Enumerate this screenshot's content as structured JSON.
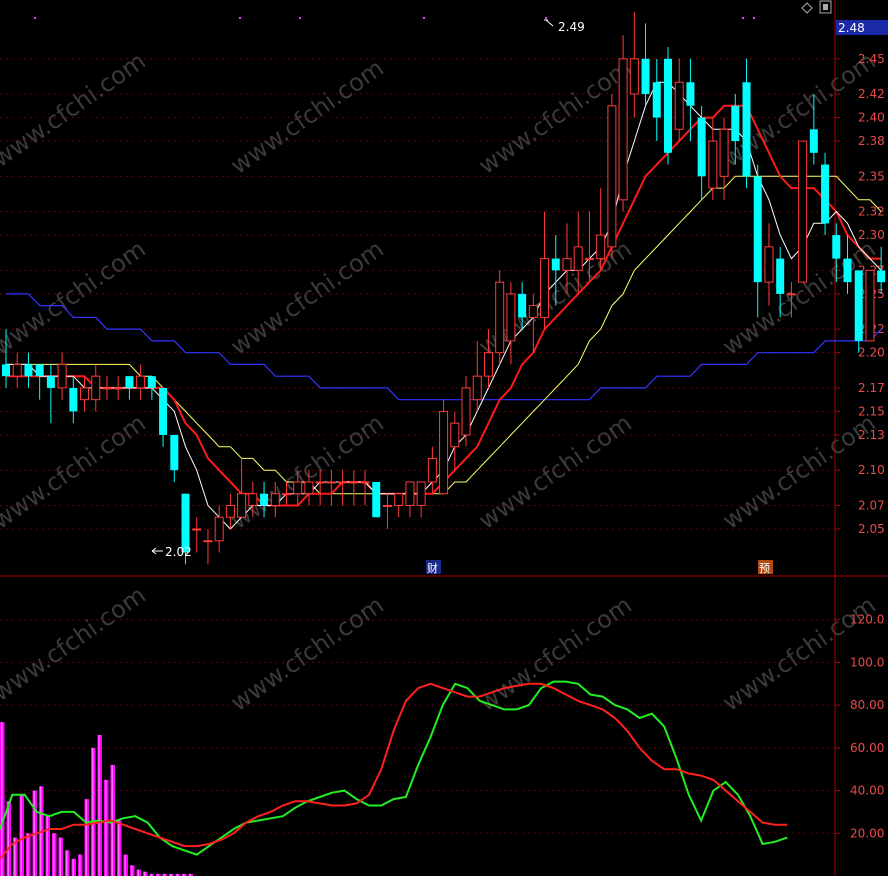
{
  "toolbar": {
    "diamond_icon": "diamond-icon",
    "window_icon": "restore-window-icon"
  },
  "price_axis": {
    "current_price": "2.48",
    "ticks": [
      "2.45",
      "2.42",
      "2.40",
      "2.38",
      "2.35",
      "2.32",
      "2.30",
      "2.27",
      "2.25",
      "2.22",
      "2.20",
      "2.17",
      "2.15",
      "2.13",
      "2.10",
      "2.07",
      "2.05"
    ]
  },
  "osc_axis": {
    "ticks": [
      "120.0",
      "100.0",
      "80.00",
      "60.00",
      "40.00",
      "20.00"
    ]
  },
  "annotations": {
    "high": "2.49",
    "low": "2.02"
  },
  "markers": {
    "earnings": "财",
    "forecast": "预"
  },
  "watermark": "www.cfchi.com",
  "colors": {
    "background": "#000000",
    "up": "#ff3a3a",
    "down": "#00ffff",
    "ma_short": "#ffffff",
    "ma_mid": "#ff1a1a",
    "ma_long": "#ffff66",
    "ma_xlong": "#3333ff",
    "osc_fast": "#22ee22",
    "osc_slow": "#ff2020",
    "osc_bars": "#ff00ff",
    "grid": "#6a0000"
  },
  "chart_data": [
    {
      "type": "candlestick",
      "ylim": [
        2.01,
        2.5
      ],
      "candles": [
        {
          "o": 2.19,
          "h": 2.22,
          "l": 2.17,
          "c": 2.18
        },
        {
          "o": 2.18,
          "h": 2.2,
          "l": 2.17,
          "c": 2.19
        },
        {
          "o": 2.19,
          "h": 2.2,
          "l": 2.17,
          "c": 2.18
        },
        {
          "o": 2.19,
          "h": 2.19,
          "l": 2.16,
          "c": 2.18
        },
        {
          "o": 2.18,
          "h": 2.19,
          "l": 2.14,
          "c": 2.17
        },
        {
          "o": 2.17,
          "h": 2.2,
          "l": 2.16,
          "c": 2.19
        },
        {
          "o": 2.17,
          "h": 2.18,
          "l": 2.14,
          "c": 2.15
        },
        {
          "o": 2.16,
          "h": 2.18,
          "l": 2.15,
          "c": 2.17
        },
        {
          "o": 2.16,
          "h": 2.19,
          "l": 2.15,
          "c": 2.18
        },
        {
          "o": 2.17,
          "h": 2.18,
          "l": 2.16,
          "c": 2.17
        },
        {
          "o": 2.17,
          "h": 2.18,
          "l": 2.16,
          "c": 2.17
        },
        {
          "o": 2.18,
          "h": 2.18,
          "l": 2.16,
          "c": 2.17
        },
        {
          "o": 2.17,
          "h": 2.19,
          "l": 2.16,
          "c": 2.18
        },
        {
          "o": 2.18,
          "h": 2.18,
          "l": 2.16,
          "c": 2.17
        },
        {
          "o": 2.17,
          "h": 2.17,
          "l": 2.12,
          "c": 2.13
        },
        {
          "o": 2.13,
          "h": 2.13,
          "l": 2.09,
          "c": 2.1
        },
        {
          "o": 2.08,
          "h": 2.08,
          "l": 2.02,
          "c": 2.03
        },
        {
          "o": 2.05,
          "h": 2.06,
          "l": 2.03,
          "c": 2.05
        },
        {
          "o": 2.04,
          "h": 2.05,
          "l": 2.02,
          "c": 2.04
        },
        {
          "o": 2.04,
          "h": 2.07,
          "l": 2.03,
          "c": 2.06
        },
        {
          "o": 2.06,
          "h": 2.08,
          "l": 2.05,
          "c": 2.07
        },
        {
          "o": 2.06,
          "h": 2.11,
          "l": 2.06,
          "c": 2.08
        },
        {
          "o": 2.07,
          "h": 2.09,
          "l": 2.06,
          "c": 2.08
        },
        {
          "o": 2.08,
          "h": 2.09,
          "l": 2.06,
          "c": 2.07
        },
        {
          "o": 2.07,
          "h": 2.09,
          "l": 2.06,
          "c": 2.08
        },
        {
          "o": 2.08,
          "h": 2.09,
          "l": 2.07,
          "c": 2.08
        },
        {
          "o": 2.08,
          "h": 2.1,
          "l": 2.07,
          "c": 2.09
        },
        {
          "o": 2.08,
          "h": 2.1,
          "l": 2.07,
          "c": 2.09
        },
        {
          "o": 2.09,
          "h": 2.1,
          "l": 2.07,
          "c": 2.09
        },
        {
          "o": 2.09,
          "h": 2.1,
          "l": 2.07,
          "c": 2.09
        },
        {
          "o": 2.09,
          "h": 2.1,
          "l": 2.07,
          "c": 2.09
        },
        {
          "o": 2.09,
          "h": 2.1,
          "l": 2.07,
          "c": 2.09
        },
        {
          "o": 2.09,
          "h": 2.1,
          "l": 2.07,
          "c": 2.09
        },
        {
          "o": 2.09,
          "h": 2.09,
          "l": 2.06,
          "c": 2.06
        },
        {
          "o": 2.07,
          "h": 2.08,
          "l": 2.05,
          "c": 2.07
        },
        {
          "o": 2.07,
          "h": 2.08,
          "l": 2.06,
          "c": 2.08
        },
        {
          "o": 2.07,
          "h": 2.09,
          "l": 2.06,
          "c": 2.09
        },
        {
          "o": 2.07,
          "h": 2.09,
          "l": 2.06,
          "c": 2.09
        },
        {
          "o": 2.09,
          "h": 2.12,
          "l": 2.08,
          "c": 2.11
        },
        {
          "o": 2.08,
          "h": 2.16,
          "l": 2.08,
          "c": 2.15
        },
        {
          "o": 2.12,
          "h": 2.15,
          "l": 2.1,
          "c": 2.14
        },
        {
          "o": 2.13,
          "h": 2.18,
          "l": 2.12,
          "c": 2.17
        },
        {
          "o": 2.16,
          "h": 2.21,
          "l": 2.15,
          "c": 2.18
        },
        {
          "o": 2.18,
          "h": 2.22,
          "l": 2.17,
          "c": 2.2
        },
        {
          "o": 2.2,
          "h": 2.27,
          "l": 2.19,
          "c": 2.26
        },
        {
          "o": 2.21,
          "h": 2.26,
          "l": 2.19,
          "c": 2.25
        },
        {
          "o": 2.25,
          "h": 2.26,
          "l": 2.22,
          "c": 2.23
        },
        {
          "o": 2.23,
          "h": 2.25,
          "l": 2.2,
          "c": 2.24
        },
        {
          "o": 2.23,
          "h": 2.32,
          "l": 2.22,
          "c": 2.28
        },
        {
          "o": 2.28,
          "h": 2.3,
          "l": 2.24,
          "c": 2.27
        },
        {
          "o": 2.27,
          "h": 2.31,
          "l": 2.25,
          "c": 2.28
        },
        {
          "o": 2.27,
          "h": 2.32,
          "l": 2.25,
          "c": 2.29
        },
        {
          "o": 2.28,
          "h": 2.32,
          "l": 2.26,
          "c": 2.28
        },
        {
          "o": 2.28,
          "h": 2.34,
          "l": 2.27,
          "c": 2.3
        },
        {
          "o": 2.29,
          "h": 2.42,
          "l": 2.28,
          "c": 2.41
        },
        {
          "o": 2.33,
          "h": 2.47,
          "l": 2.32,
          "c": 2.45
        },
        {
          "o": 2.42,
          "h": 2.49,
          "l": 2.4,
          "c": 2.45
        },
        {
          "o": 2.45,
          "h": 2.48,
          "l": 2.41,
          "c": 2.42
        },
        {
          "o": 2.43,
          "h": 2.45,
          "l": 2.38,
          "c": 2.4
        },
        {
          "o": 2.45,
          "h": 2.46,
          "l": 2.36,
          "c": 2.37
        },
        {
          "o": 2.39,
          "h": 2.45,
          "l": 2.38,
          "c": 2.43
        },
        {
          "o": 2.43,
          "h": 2.45,
          "l": 2.38,
          "c": 2.41
        },
        {
          "o": 2.4,
          "h": 2.41,
          "l": 2.33,
          "c": 2.35
        },
        {
          "o": 2.34,
          "h": 2.4,
          "l": 2.33,
          "c": 2.38
        },
        {
          "o": 2.35,
          "h": 2.4,
          "l": 2.33,
          "c": 2.39
        },
        {
          "o": 2.41,
          "h": 2.42,
          "l": 2.36,
          "c": 2.38
        },
        {
          "o": 2.43,
          "h": 2.45,
          "l": 2.34,
          "c": 2.35
        },
        {
          "o": 2.35,
          "h": 2.36,
          "l": 2.23,
          "c": 2.26
        },
        {
          "o": 2.26,
          "h": 2.31,
          "l": 2.24,
          "c": 2.29
        },
        {
          "o": 2.28,
          "h": 2.29,
          "l": 2.23,
          "c": 2.25
        },
        {
          "o": 2.25,
          "h": 2.26,
          "l": 2.23,
          "c": 2.25
        },
        {
          "o": 2.26,
          "h": 2.38,
          "l": 2.26,
          "c": 2.38
        },
        {
          "o": 2.39,
          "h": 2.42,
          "l": 2.36,
          "c": 2.37
        },
        {
          "o": 2.36,
          "h": 2.37,
          "l": 2.3,
          "c": 2.31
        },
        {
          "o": 2.3,
          "h": 2.31,
          "l": 2.26,
          "c": 2.28
        },
        {
          "o": 2.28,
          "h": 2.3,
          "l": 2.25,
          "c": 2.26
        },
        {
          "o": 2.27,
          "h": 2.27,
          "l": 2.2,
          "c": 2.21
        },
        {
          "o": 2.21,
          "h": 2.27,
          "l": 2.21,
          "c": 2.27
        },
        {
          "o": 2.27,
          "h": 2.29,
          "l": 2.25,
          "c": 2.26
        }
      ],
      "ma_short": [
        2.19,
        2.19,
        2.19,
        2.18,
        2.18,
        2.18,
        2.18,
        2.17,
        2.17,
        2.17,
        2.17,
        2.17,
        2.17,
        2.17,
        2.16,
        2.15,
        2.12,
        2.1,
        2.07,
        2.06,
        2.05,
        2.06,
        2.07,
        2.07,
        2.07,
        2.08,
        2.08,
        2.08,
        2.09,
        2.09,
        2.09,
        2.09,
        2.09,
        2.08,
        2.08,
        2.08,
        2.08,
        2.08,
        2.09,
        2.1,
        2.12,
        2.13,
        2.15,
        2.17,
        2.19,
        2.21,
        2.22,
        2.23,
        2.25,
        2.26,
        2.27,
        2.27,
        2.28,
        2.29,
        2.31,
        2.35,
        2.38,
        2.41,
        2.43,
        2.43,
        2.42,
        2.41,
        2.4,
        2.39,
        2.39,
        2.39,
        2.38,
        2.35,
        2.33,
        2.3,
        2.28,
        2.29,
        2.31,
        2.31,
        2.32,
        2.31,
        2.29,
        2.28,
        2.27
      ],
      "ma_mid": [
        2.18,
        2.18,
        2.18,
        2.18,
        2.18,
        2.18,
        2.18,
        2.18,
        2.17,
        2.17,
        2.17,
        2.17,
        2.17,
        2.17,
        2.17,
        2.16,
        2.14,
        2.13,
        2.11,
        2.1,
        2.09,
        2.08,
        2.08,
        2.07,
        2.07,
        2.07,
        2.07,
        2.08,
        2.08,
        2.08,
        2.09,
        2.09,
        2.09,
        2.08,
        2.08,
        2.08,
        2.08,
        2.08,
        2.08,
        2.09,
        2.1,
        2.11,
        2.12,
        2.14,
        2.16,
        2.17,
        2.19,
        2.2,
        2.22,
        2.23,
        2.24,
        2.25,
        2.26,
        2.27,
        2.29,
        2.31,
        2.33,
        2.35,
        2.36,
        2.37,
        2.38,
        2.39,
        2.4,
        2.4,
        2.41,
        2.41,
        2.41,
        2.39,
        2.37,
        2.35,
        2.34,
        2.34,
        2.34,
        2.33,
        2.32,
        2.3,
        2.29,
        2.28,
        2.28
      ],
      "ma_long": [
        2.19,
        2.19,
        2.19,
        2.19,
        2.19,
        2.19,
        2.19,
        2.19,
        2.19,
        2.19,
        2.19,
        2.19,
        2.18,
        2.18,
        2.17,
        2.16,
        2.15,
        2.14,
        2.13,
        2.12,
        2.12,
        2.11,
        2.11,
        2.1,
        2.1,
        2.09,
        2.09,
        2.09,
        2.08,
        2.08,
        2.08,
        2.08,
        2.08,
        2.08,
        2.08,
        2.08,
        2.08,
        2.08,
        2.08,
        2.08,
        2.09,
        2.09,
        2.1,
        2.11,
        2.12,
        2.13,
        2.14,
        2.15,
        2.16,
        2.17,
        2.18,
        2.19,
        2.21,
        2.22,
        2.24,
        2.25,
        2.27,
        2.28,
        2.29,
        2.3,
        2.31,
        2.32,
        2.33,
        2.34,
        2.34,
        2.35,
        2.35,
        2.35,
        2.35,
        2.35,
        2.35,
        2.35,
        2.35,
        2.35,
        2.35,
        2.34,
        2.33,
        2.33,
        2.32
      ],
      "ma_xlong": [
        2.25,
        2.25,
        2.25,
        2.24,
        2.24,
        2.24,
        2.23,
        2.23,
        2.23,
        2.22,
        2.22,
        2.22,
        2.22,
        2.21,
        2.21,
        2.21,
        2.2,
        2.2,
        2.2,
        2.2,
        2.19,
        2.19,
        2.19,
        2.19,
        2.18,
        2.18,
        2.18,
        2.18,
        2.17,
        2.17,
        2.17,
        2.17,
        2.17,
        2.17,
        2.17,
        2.16,
        2.16,
        2.16,
        2.16,
        2.16,
        2.16,
        2.16,
        2.16,
        2.16,
        2.16,
        2.16,
        2.16,
        2.16,
        2.16,
        2.16,
        2.16,
        2.16,
        2.16,
        2.17,
        2.17,
        2.17,
        2.17,
        2.17,
        2.18,
        2.18,
        2.18,
        2.18,
        2.19,
        2.19,
        2.19,
        2.19,
        2.19,
        2.2,
        2.2,
        2.2,
        2.2,
        2.2,
        2.2,
        2.21,
        2.21,
        2.21,
        2.21,
        2.21,
        2.22
      ]
    },
    {
      "type": "line",
      "ylim": [
        0,
        140
      ],
      "series": [
        {
          "values": [
            22,
            38,
            38,
            30,
            28,
            30,
            30,
            25,
            26,
            25,
            27,
            28,
            25,
            18,
            14,
            12,
            10,
            14,
            18,
            22,
            25,
            26,
            27,
            28,
            32,
            35,
            37,
            39,
            40,
            36,
            33,
            33,
            36,
            37,
            52,
            65,
            80,
            90,
            88,
            82,
            80,
            78,
            78,
            80,
            88,
            91,
            91,
            90,
            85,
            84,
            80,
            78,
            74,
            76,
            70,
            55,
            38,
            26,
            40,
            44,
            38,
            28,
            15,
            16,
            18
          ]
        },
        {
          "values": [
            8,
            15,
            18,
            20,
            22,
            22,
            24,
            24,
            25,
            26,
            24,
            22,
            20,
            18,
            16,
            14,
            14,
            15,
            17,
            20,
            25,
            28,
            30,
            33,
            35,
            35,
            34,
            33,
            33,
            34,
            38,
            50,
            68,
            82,
            88,
            90,
            88,
            86,
            84,
            84,
            86,
            88,
            89,
            90,
            90,
            88,
            85,
            82,
            80,
            78,
            74,
            68,
            60,
            54,
            50,
            50,
            48,
            47,
            45,
            40,
            35,
            30,
            25,
            24,
            24
          ]
        }
      ],
      "bars": [
        72,
        35,
        18,
        38,
        20,
        40,
        42,
        28,
        20,
        18,
        12,
        8,
        10,
        36,
        60,
        66,
        45,
        52,
        26,
        10,
        5,
        3,
        2,
        1,
        1,
        1,
        1,
        1,
        1,
        1,
        0,
        0,
        0,
        0,
        0,
        0,
        0,
        0,
        0,
        0
      ]
    }
  ]
}
